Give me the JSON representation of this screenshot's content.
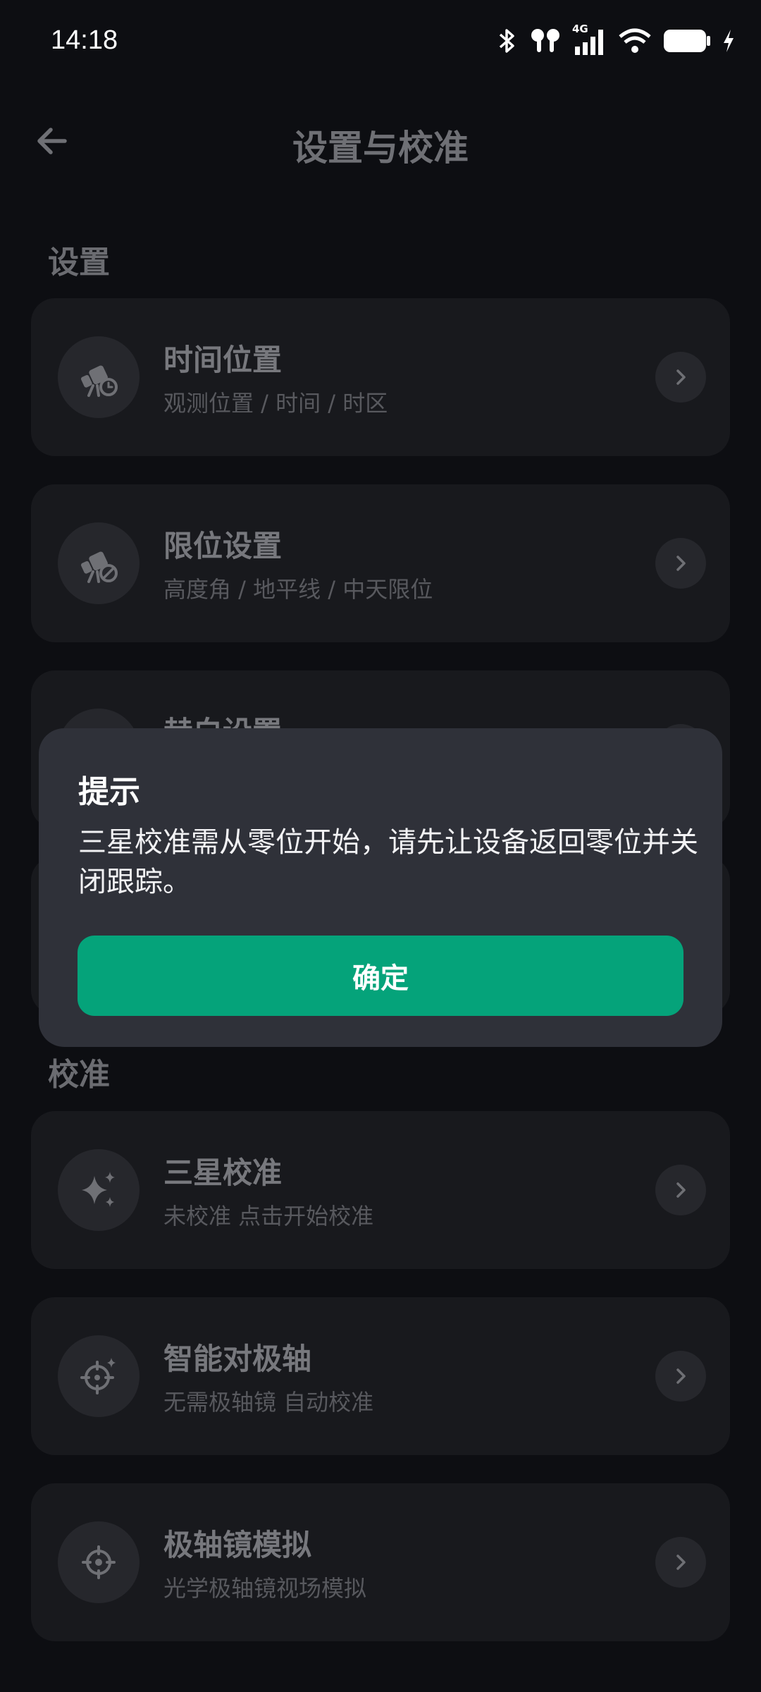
{
  "status": {
    "time": "14:18",
    "network_label": "4G",
    "icons": [
      "bluetooth-icon",
      "earbuds-icon",
      "signal-icon",
      "wifi-icon",
      "battery-icon",
      "charging-icon"
    ]
  },
  "header": {
    "title": "设置与校准"
  },
  "sections": {
    "settings": "设置",
    "calibration": "校准"
  },
  "settings_items": [
    {
      "title": "时间位置",
      "subtitle": "观测位置 / 时间 / 时区",
      "icon": "telescope-clock-icon"
    },
    {
      "title": "限位设置",
      "subtitle": "高度角 / 地平线 / 中天限位",
      "icon": "telescope-limit-icon"
    },
    {
      "title": "赫白设置",
      "subtitle": "",
      "icon": "telescope-icon"
    }
  ],
  "calibration_items": [
    {
      "title": "三星校准",
      "subtitle": "未校准 点击开始校准",
      "icon": "sparkle-stars-icon"
    },
    {
      "title": "智能对极轴",
      "subtitle": "无需极轴镜 自动校准",
      "icon": "crosshair-sparkle-icon"
    },
    {
      "title": "极轴镜模拟",
      "subtitle": "光学极轴镜视场模拟",
      "icon": "crosshair-icon"
    }
  ],
  "dialog": {
    "title": "提示",
    "message": "三星校准需从零位开始，请先让设备返回零位并关闭跟踪。",
    "confirm_label": "确定"
  },
  "colors": {
    "background": "#0d0e12",
    "card": "#18191d",
    "dialog": "#2f3139",
    "accent": "#05a37a"
  }
}
